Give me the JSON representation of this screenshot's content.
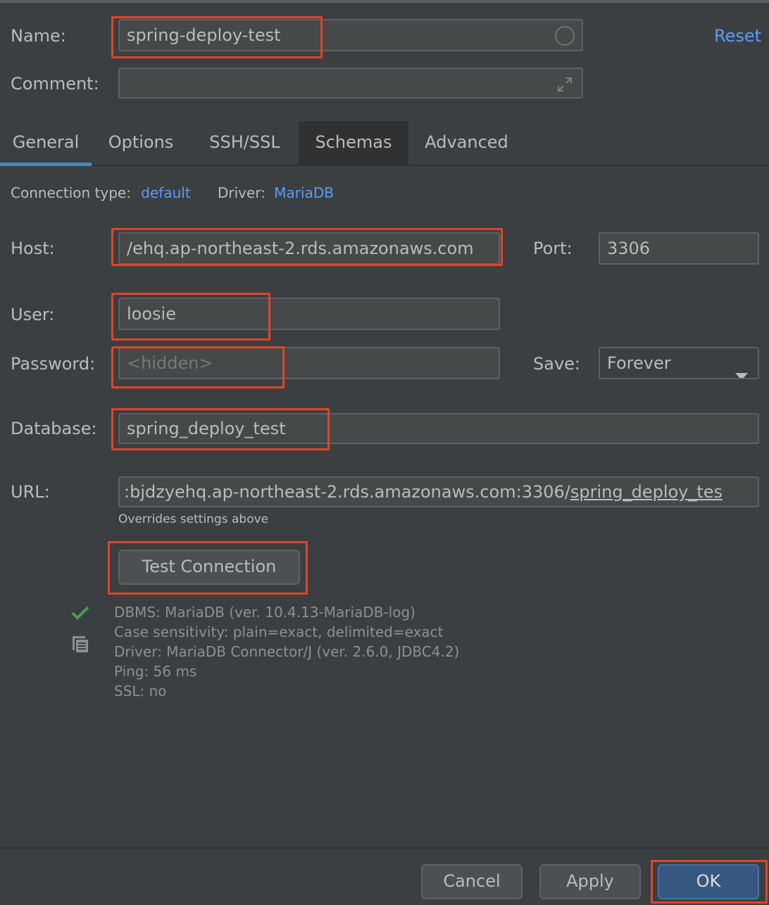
{
  "form": {
    "name_label": "Name:",
    "name_value": "spring-deploy-test",
    "reset_label": "Reset",
    "comment_label": "Comment:",
    "comment_value": ""
  },
  "tabs": [
    {
      "label": "General"
    },
    {
      "label": "Options"
    },
    {
      "label": "SSH/SSL"
    },
    {
      "label": "Schemas"
    },
    {
      "label": "Advanced"
    }
  ],
  "general": {
    "connection_type_label": "Connection type:",
    "connection_type_value": "default",
    "driver_label": "Driver:",
    "driver_value": "MariaDB",
    "host_label": "Host:",
    "host_value": "/ehq.ap-northeast-2.rds.amazonaws.com",
    "port_label": "Port:",
    "port_value": "3306",
    "user_label": "User:",
    "user_value": "loosie",
    "password_label": "Password:",
    "password_placeholder": "<hidden>",
    "save_label": "Save:",
    "save_value": "Forever",
    "database_label": "Database:",
    "database_value": "spring_deploy_test",
    "url_label": "URL:",
    "url_prefix": ":bjdzyehq.ap-northeast-2.rds.amazonaws.com:3306/",
    "url_db": "spring_deploy_tes",
    "url_hint": "Overrides settings above",
    "test_button": "Test Connection"
  },
  "result": {
    "lines": [
      "DBMS: MariaDB (ver. 10.4.13-MariaDB-log)",
      "Case sensitivity: plain=exact, delimited=exact",
      "Driver: MariaDB Connector/J (ver. 2.6.0, JDBC4.2)",
      "Ping: 56 ms",
      "SSL: no"
    ],
    "status_icon": "check-icon",
    "copy_icon": "copy-icon"
  },
  "footer": {
    "cancel_label": "Cancel",
    "apply_label": "Apply",
    "ok_label": "OK"
  },
  "colors": {
    "background": "#3c3f41",
    "link": "#589df6",
    "highlight": "#e0442a",
    "ok_button": "#365880",
    "success": "#499c54"
  }
}
